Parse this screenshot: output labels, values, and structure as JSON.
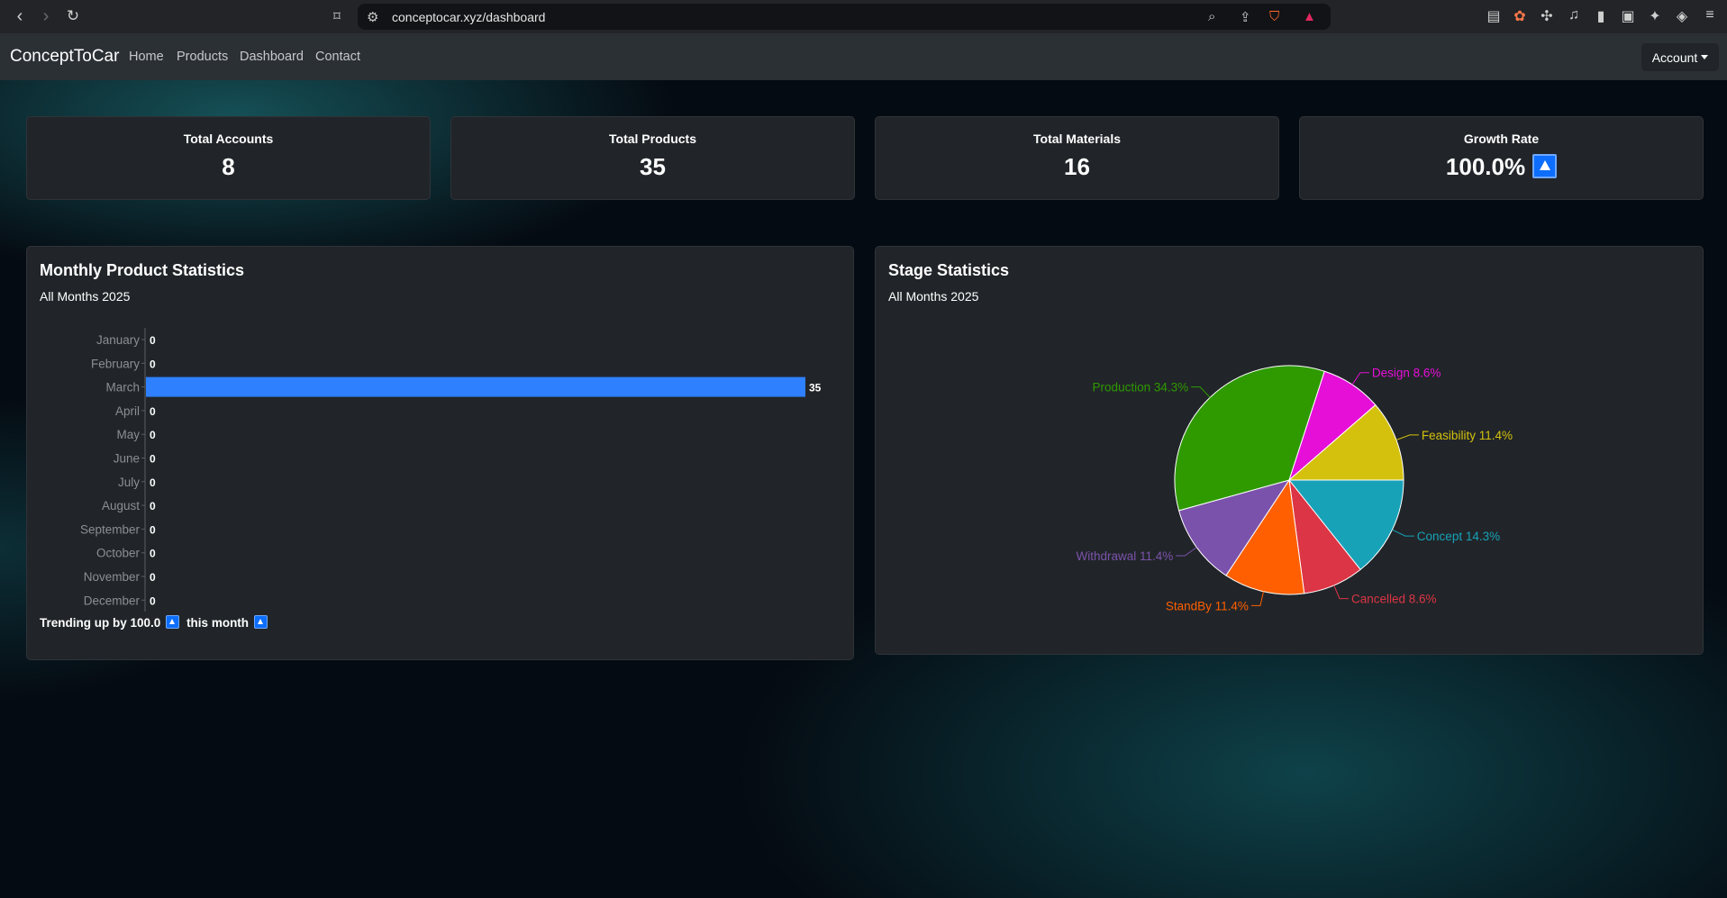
{
  "browser": {
    "url": "conceptocar.xyz/dashboard"
  },
  "navbar": {
    "brand": "ConceptToCar",
    "links": [
      "Home",
      "Products",
      "Dashboard",
      "Contact"
    ],
    "account_label": "Account"
  },
  "stats": [
    {
      "title": "Total Accounts",
      "value": "8"
    },
    {
      "title": "Total Products",
      "value": "35"
    },
    {
      "title": "Total Materials",
      "value": "16"
    },
    {
      "title": "Growth Rate",
      "value": "100.0%"
    }
  ],
  "monthly_panel": {
    "title": "Monthly Product Statistics",
    "subtitle": "All Months 2025",
    "trend_prefix": "Trending up by 100.0",
    "trend_suffix": "this month"
  },
  "stage_panel": {
    "title": "Stage Statistics",
    "subtitle": "All Months 2025"
  },
  "chart_data": [
    {
      "type": "bar",
      "orientation": "horizontal",
      "categories": [
        "January",
        "February",
        "March",
        "April",
        "May",
        "June",
        "July",
        "August",
        "September",
        "October",
        "November",
        "December"
      ],
      "values": [
        0,
        0,
        35,
        0,
        0,
        0,
        0,
        0,
        0,
        0,
        0,
        0
      ],
      "xlim": [
        0,
        35
      ],
      "color": "#2f80ff",
      "data_labels": true
    },
    {
      "type": "pie",
      "slices": [
        {
          "label": "Concept 14.3%",
          "value": 14.3,
          "color": "#17a2b8"
        },
        {
          "label": "Cancelled 8.6%",
          "value": 8.6,
          "color": "#dc3545"
        },
        {
          "label": "StandBy 11.4%",
          "value": 11.4,
          "color": "#ff5f00"
        },
        {
          "label": "Withdrawal 11.4%",
          "value": 11.4,
          "color": "#7b52ab"
        },
        {
          "label": "Production 34.3%",
          "value": 34.3,
          "color": "#2e9a00"
        },
        {
          "label": "Design 8.6%",
          "value": 8.6,
          "color": "#e60fd8"
        },
        {
          "label": "Feasibility 11.4%",
          "value": 11.4,
          "color": "#d4c10d"
        }
      ]
    }
  ]
}
